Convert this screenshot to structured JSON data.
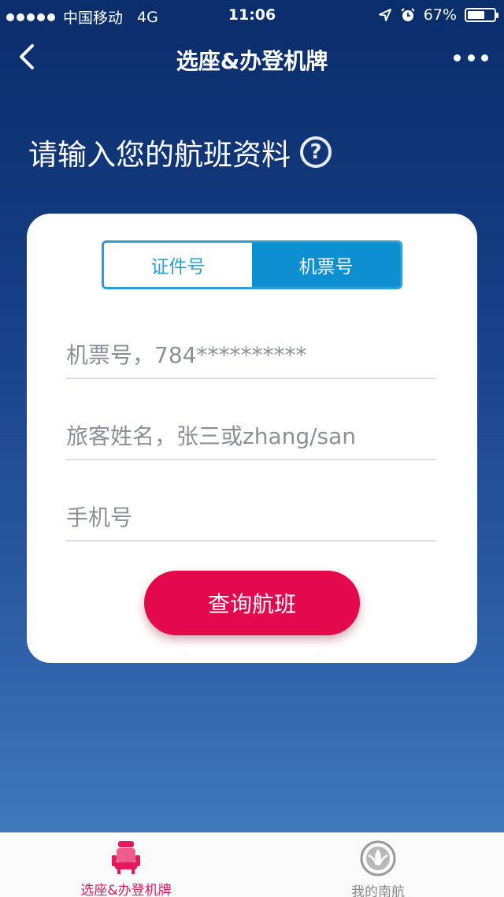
{
  "status_bar": {
    "carrier": "中国移动",
    "network": "4G",
    "time": "11:06",
    "battery_percent_text": "67%",
    "battery_level": 0.67
  },
  "nav": {
    "title": "选座&办登机牌",
    "back_icon": "chevron-left-icon",
    "more_icon": "more-dots-icon"
  },
  "heading": {
    "text": "请输入您的航班资料",
    "help_symbol": "?"
  },
  "segment": {
    "options": [
      {
        "label": "证件号",
        "active": false
      },
      {
        "label": "机票号",
        "active": true
      }
    ],
    "accent_color": "#0d8fd2"
  },
  "form": {
    "ticket": {
      "value": "",
      "placeholder": "机票号，784**********"
    },
    "name": {
      "value": "",
      "placeholder": "旅客姓名，张三或zhang/san"
    },
    "phone": {
      "value": "",
      "placeholder": "手机号"
    }
  },
  "query_button": {
    "label": "查询航班",
    "color": "#e3094c"
  },
  "tab_bar": {
    "tabs": [
      {
        "label": "选座&办登机牌",
        "icon": "seat-icon",
        "active": true
      },
      {
        "label": "我的南航",
        "icon": "airline-logo-icon",
        "active": false
      }
    ],
    "active_color": "#e3195c"
  }
}
